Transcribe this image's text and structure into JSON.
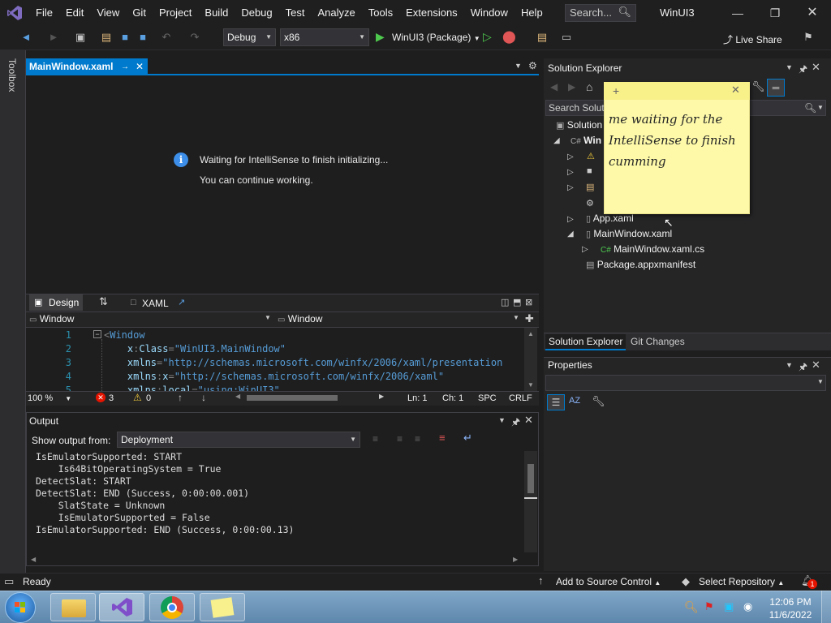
{
  "menu": {
    "items": [
      "File",
      "Edit",
      "View",
      "Git",
      "Project",
      "Build",
      "Debug",
      "Test",
      "Analyze",
      "Tools",
      "Extensions",
      "Window",
      "Help"
    ],
    "search_placeholder": "Search...",
    "window_title": "WinUI3"
  },
  "toolbar": {
    "config": "Debug",
    "platform": "x86",
    "run_target": "WinUI3 (Package)",
    "live_share": "Live Share"
  },
  "toolbox_label": "Toolbox",
  "document": {
    "tab_label": "MainWindow.xaml",
    "info_line1": "Waiting for IntelliSense to finish initializing...",
    "info_line2": "You can continue working.",
    "design_tab": "Design",
    "xaml_tab": "XAML",
    "nav_left": "Window",
    "nav_right": "Window",
    "code": [
      {
        "num": "1",
        "parts": [
          {
            "t": "<",
            "c": "punct"
          },
          {
            "t": "Window",
            "c": "kw"
          }
        ]
      },
      {
        "num": "2",
        "parts": [
          {
            "t": "    x",
            "c": "attr"
          },
          {
            "t": ":",
            "c": "punct"
          },
          {
            "t": "Class",
            "c": "attr"
          },
          {
            "t": "=",
            "c": "punct"
          },
          {
            "t": "\"WinUI3.MainWindow\"",
            "c": "kw"
          }
        ]
      },
      {
        "num": "3",
        "parts": [
          {
            "t": "    xmlns",
            "c": "attr"
          },
          {
            "t": "=",
            "c": "punct"
          },
          {
            "t": "\"http://schemas.microsoft.com/winfx/2006/xaml/presentation",
            "c": "kw"
          }
        ]
      },
      {
        "num": "4",
        "parts": [
          {
            "t": "    xmlns",
            "c": "attr"
          },
          {
            "t": ":",
            "c": "punct"
          },
          {
            "t": "x",
            "c": "attr"
          },
          {
            "t": "=",
            "c": "punct"
          },
          {
            "t": "\"http://schemas.microsoft.com/winfx/2006/xaml\"",
            "c": "kw"
          }
        ]
      },
      {
        "num": "5",
        "parts": [
          {
            "t": "    xmlns",
            "c": "attr"
          },
          {
            "t": ":",
            "c": "punct"
          },
          {
            "t": "local",
            "c": "attr"
          },
          {
            "t": "=",
            "c": "punct"
          },
          {
            "t": "\"using:WinUI3\"",
            "c": "kw"
          }
        ]
      }
    ],
    "status": {
      "zoom": "100 %",
      "errors": "3",
      "warnings": "0",
      "line": "Ln: 1",
      "col": "Ch: 1",
      "spc": "SPC",
      "crlf": "CRLF"
    }
  },
  "output": {
    "title": "Output",
    "show_from_label": "Show output from:",
    "source": "Deployment",
    "lines": "IsEmulatorSupported: START\n    Is64BitOperatingSystem = True\nDetectSlat: START\nDetectSlat: END (Success, 0:00:00.001)\n    SlatState = Unknown\n    IsEmulatorSupported = False\nIsEmulatorSupported: END (Success, 0:00:00.13)"
  },
  "solution_explorer": {
    "title": "Solution Explorer",
    "search_placeholder": "Search Soluti",
    "tree": {
      "solution": "Solution",
      "project": "Win",
      "app_xaml": "App.xaml",
      "main_window": "MainWindow.xaml",
      "main_window_cs": "MainWindow.xaml.cs",
      "manifest": "Package.appxmanifest"
    },
    "tabs": [
      "Solution Explorer",
      "Git Changes"
    ]
  },
  "properties": {
    "title": "Properties"
  },
  "sticky_note": {
    "text": "me waiting for the IntelliSense to finish cumming"
  },
  "status_bar": {
    "ready": "Ready",
    "add_source": "Add to Source Control",
    "select_repo": "Select Repository",
    "notifications": "1"
  },
  "taskbar": {
    "time": "12:06 PM",
    "date": "11/6/2022"
  }
}
